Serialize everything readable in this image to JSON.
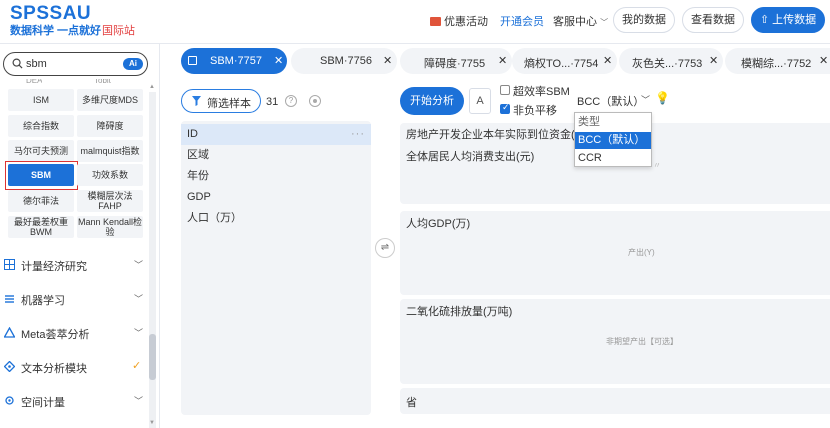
{
  "header": {
    "logo": "SPSSAU",
    "slogan": "数据科学 一点就好",
    "intl": "国际站",
    "promo": "优惠活动",
    "vip": "开通会员",
    "customer_service": "客服中心",
    "my_data": "我的数据",
    "view_data": "查看数据",
    "upload": "上传数据"
  },
  "sidebar": {
    "search": {
      "value": "sbm",
      "placeholder": "",
      "ai_badge": "Ai"
    },
    "cut_top_left": "DEA",
    "cut_top_right": "Tobit",
    "methods": [
      "ISM",
      "多维尺度MDS",
      "综合指数",
      "障碍度",
      "马尔可夫预测",
      "malmquist指数",
      "SBM",
      "功效系数",
      "德尔菲法",
      "模糊层次法FAHP",
      "最好最差权重BWM",
      "Mann Kendall检验"
    ],
    "categories": [
      {
        "label": "计量经济研究"
      },
      {
        "label": "机器学习"
      },
      {
        "label": "Meta荟萃分析"
      },
      {
        "label": "文本分析模块"
      },
      {
        "label": "空间计量"
      }
    ]
  },
  "tabs": [
    {
      "label": "SBM·7757"
    },
    {
      "label": "SBM·7756"
    },
    {
      "label": "障碍度·7755"
    },
    {
      "label": "熵权TO...·7754"
    },
    {
      "label": "灰色关...·7753"
    },
    {
      "label": "模糊综...·7752"
    }
  ],
  "left_panel": {
    "filter_label": "筛选样本",
    "count": "31",
    "help": "?",
    "more": "···",
    "variables": [
      "ID",
      "区域",
      "年份",
      "GDP",
      "人口（万）"
    ]
  },
  "toolbar": {
    "start": "开始分析",
    "brush": "A",
    "super_eff": "超效率SBM",
    "nonneg": "非负平移",
    "model_value": "BCC（默认）",
    "dropdown": [
      "类型",
      "BCC（默认）",
      "CCR"
    ]
  },
  "panels": {
    "input": {
      "rows": [
        "房地产开发企业本年实际到位资金(亿元)",
        "全体居民人均消费支出(元)"
      ]
    },
    "output": {
      "rows": [
        "人均GDP(万)"
      ],
      "placeholder": "产出(Y)"
    },
    "undesired": {
      "rows": [
        "二氧化硫排放量(万吨)"
      ],
      "placeholder": "非期望产出【可选】"
    },
    "extra": {
      "rows": [
        "省"
      ]
    }
  }
}
